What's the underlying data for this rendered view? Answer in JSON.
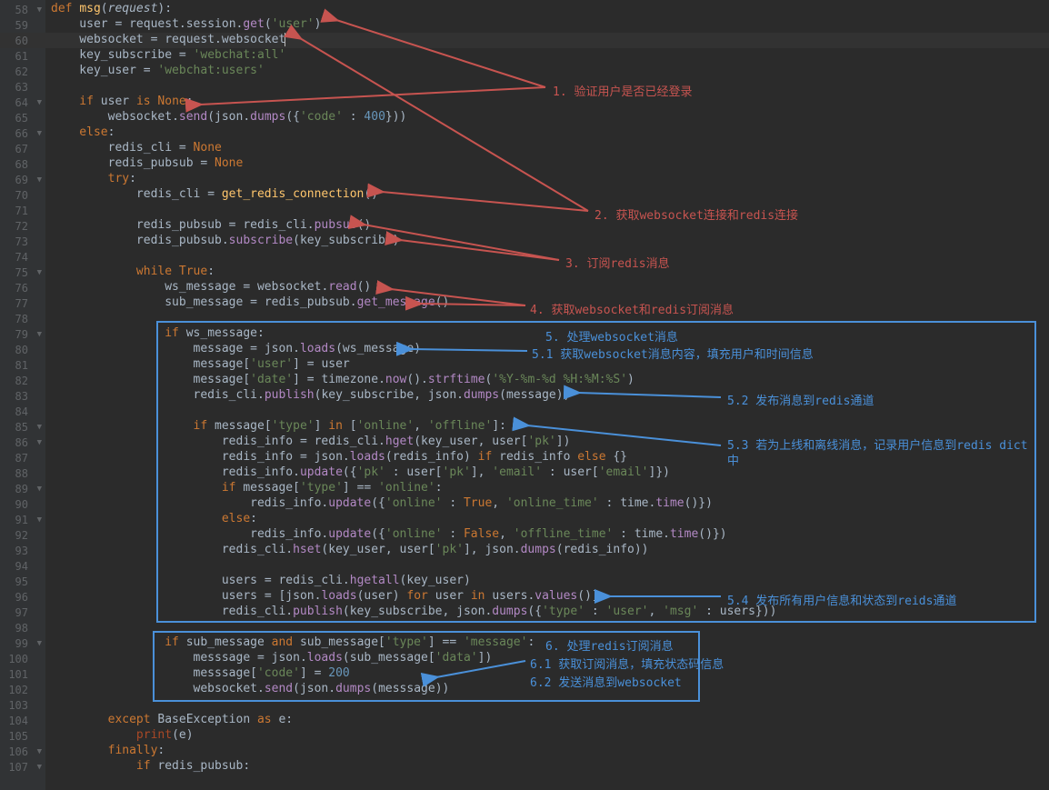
{
  "gutter": {
    "start": 58,
    "end": 107,
    "fold_lines": [
      58,
      64,
      66,
      69,
      75,
      79,
      85,
      86,
      89,
      91,
      99,
      106,
      107
    ],
    "highlight": 60
  },
  "code": [
    [
      [
        "kw",
        "def "
      ],
      [
        "fn",
        "msg"
      ],
      [
        "op",
        "("
      ],
      [
        "par",
        "request"
      ],
      [
        "op",
        "):"
      ]
    ],
    [
      [
        "id",
        "    user "
      ],
      [
        "op",
        "= "
      ],
      [
        "id",
        "request"
      ],
      [
        "op",
        "."
      ],
      [
        "id",
        "session"
      ],
      [
        "op",
        "."
      ],
      [
        "me",
        "get"
      ],
      [
        "op",
        "("
      ],
      [
        "str",
        "'user'"
      ],
      [
        "op",
        ")"
      ]
    ],
    [
      [
        "id",
        "    websocket "
      ],
      [
        "op",
        "= "
      ],
      [
        "id",
        "request"
      ],
      [
        "op",
        "."
      ],
      [
        "id",
        "websocket"
      ]
    ],
    [
      [
        "id",
        "    key_subscribe "
      ],
      [
        "op",
        "= "
      ],
      [
        "str",
        "'webchat:all'"
      ]
    ],
    [
      [
        "id",
        "    key_user "
      ],
      [
        "op",
        "= "
      ],
      [
        "str",
        "'webchat:users'"
      ]
    ],
    [
      [
        "id",
        ""
      ]
    ],
    [
      [
        "kw",
        "    if "
      ],
      [
        "id",
        "user "
      ],
      [
        "kw",
        "is "
      ],
      [
        "bl",
        "None"
      ],
      [
        "op",
        ":"
      ]
    ],
    [
      [
        "id",
        "        websocket"
      ],
      [
        "op",
        "."
      ],
      [
        "me",
        "send"
      ],
      [
        "op",
        "("
      ],
      [
        "id",
        "json"
      ],
      [
        "op",
        "."
      ],
      [
        "me",
        "dumps"
      ],
      [
        "op",
        "({"
      ],
      [
        "str",
        "'code'"
      ],
      [
        "op",
        " : "
      ],
      [
        "num",
        "400"
      ],
      [
        "op",
        "}))"
      ]
    ],
    [
      [
        "kw",
        "    else"
      ],
      [
        "op",
        ":"
      ]
    ],
    [
      [
        "id",
        "        redis_cli "
      ],
      [
        "op",
        "= "
      ],
      [
        "bl",
        "None"
      ]
    ],
    [
      [
        "id",
        "        redis_pubsub "
      ],
      [
        "op",
        "= "
      ],
      [
        "bl",
        "None"
      ]
    ],
    [
      [
        "kw",
        "        try"
      ],
      [
        "op",
        ":"
      ]
    ],
    [
      [
        "id",
        "            redis_cli "
      ],
      [
        "op",
        "= "
      ],
      [
        "fn",
        "get_redis_connection"
      ],
      [
        "op",
        "()"
      ]
    ],
    [
      [
        "id",
        ""
      ]
    ],
    [
      [
        "id",
        "            redis_pubsub "
      ],
      [
        "op",
        "= "
      ],
      [
        "id",
        "redis_cli"
      ],
      [
        "op",
        "."
      ],
      [
        "me",
        "pubsub"
      ],
      [
        "op",
        "()"
      ]
    ],
    [
      [
        "id",
        "            redis_pubsub"
      ],
      [
        "op",
        "."
      ],
      [
        "me",
        "subscribe"
      ],
      [
        "op",
        "("
      ],
      [
        "id",
        "key_subscribe"
      ],
      [
        "op",
        ")"
      ]
    ],
    [
      [
        "id",
        ""
      ]
    ],
    [
      [
        "kw",
        "            while "
      ],
      [
        "bl",
        "True"
      ],
      [
        "op",
        ":"
      ]
    ],
    [
      [
        "id",
        "                ws_message "
      ],
      [
        "op",
        "= "
      ],
      [
        "id",
        "websocket"
      ],
      [
        "op",
        "."
      ],
      [
        "me",
        "read"
      ],
      [
        "op",
        "()"
      ]
    ],
    [
      [
        "id",
        "                sub_message "
      ],
      [
        "op",
        "= "
      ],
      [
        "id",
        "redis_pubsub"
      ],
      [
        "op",
        "."
      ],
      [
        "me",
        "get_message"
      ],
      [
        "op",
        "()"
      ]
    ],
    [
      [
        "id",
        ""
      ]
    ],
    [
      [
        "kw",
        "                if "
      ],
      [
        "id",
        "ws_message"
      ],
      [
        "op",
        ":"
      ]
    ],
    [
      [
        "id",
        "                    message "
      ],
      [
        "op",
        "= "
      ],
      [
        "id",
        "json"
      ],
      [
        "op",
        "."
      ],
      [
        "me",
        "loads"
      ],
      [
        "op",
        "("
      ],
      [
        "id",
        "ws_message"
      ],
      [
        "op",
        ")"
      ]
    ],
    [
      [
        "id",
        "                    message"
      ],
      [
        "op",
        "["
      ],
      [
        "str",
        "'user'"
      ],
      [
        "op",
        "] = "
      ],
      [
        "id",
        "user"
      ]
    ],
    [
      [
        "id",
        "                    message"
      ],
      [
        "op",
        "["
      ],
      [
        "str",
        "'date'"
      ],
      [
        "op",
        "] = "
      ],
      [
        "id",
        "timezone"
      ],
      [
        "op",
        "."
      ],
      [
        "me",
        "now"
      ],
      [
        "op",
        "()."
      ],
      [
        "me",
        "strftime"
      ],
      [
        "op",
        "("
      ],
      [
        "str",
        "'%Y-%m-%d %H:%M:%S'"
      ],
      [
        "op",
        ")"
      ]
    ],
    [
      [
        "id",
        "                    redis_cli"
      ],
      [
        "op",
        "."
      ],
      [
        "me",
        "publish"
      ],
      [
        "op",
        "("
      ],
      [
        "id",
        "key_subscribe"
      ],
      [
        "op",
        ", "
      ],
      [
        "id",
        "json"
      ],
      [
        "op",
        "."
      ],
      [
        "me",
        "dumps"
      ],
      [
        "op",
        "("
      ],
      [
        "id",
        "message"
      ],
      [
        "op",
        "))"
      ]
    ],
    [
      [
        "id",
        ""
      ]
    ],
    [
      [
        "kw",
        "                    if "
      ],
      [
        "id",
        "message"
      ],
      [
        "op",
        "["
      ],
      [
        "str",
        "'type'"
      ],
      [
        "op",
        "] "
      ],
      [
        "kw",
        "in "
      ],
      [
        "op",
        "["
      ],
      [
        "str",
        "'online'"
      ],
      [
        "op",
        ", "
      ],
      [
        "str",
        "'offline'"
      ],
      [
        "op",
        "]:"
      ]
    ],
    [
      [
        "id",
        "                        redis_info "
      ],
      [
        "op",
        "= "
      ],
      [
        "id",
        "redis_cli"
      ],
      [
        "op",
        "."
      ],
      [
        "me",
        "hget"
      ],
      [
        "op",
        "("
      ],
      [
        "id",
        "key_user"
      ],
      [
        "op",
        ", "
      ],
      [
        "id",
        "user"
      ],
      [
        "op",
        "["
      ],
      [
        "str",
        "'pk'"
      ],
      [
        "op",
        "])"
      ]
    ],
    [
      [
        "id",
        "                        redis_info "
      ],
      [
        "op",
        "= "
      ],
      [
        "id",
        "json"
      ],
      [
        "op",
        "."
      ],
      [
        "me",
        "loads"
      ],
      [
        "op",
        "("
      ],
      [
        "id",
        "redis_info"
      ],
      [
        "op",
        ") "
      ],
      [
        "kw",
        "if "
      ],
      [
        "id",
        "redis_info "
      ],
      [
        "kw",
        "else "
      ],
      [
        "op",
        "{}"
      ]
    ],
    [
      [
        "id",
        "                        redis_info"
      ],
      [
        "op",
        "."
      ],
      [
        "me",
        "update"
      ],
      [
        "op",
        "({"
      ],
      [
        "str",
        "'pk'"
      ],
      [
        "op",
        " : "
      ],
      [
        "id",
        "user"
      ],
      [
        "op",
        "["
      ],
      [
        "str",
        "'pk'"
      ],
      [
        "op",
        "], "
      ],
      [
        "str",
        "'email'"
      ],
      [
        "op",
        " : "
      ],
      [
        "id",
        "user"
      ],
      [
        "op",
        "["
      ],
      [
        "str",
        "'email'"
      ],
      [
        "op",
        "]})"
      ]
    ],
    [
      [
        "kw",
        "                        if "
      ],
      [
        "id",
        "message"
      ],
      [
        "op",
        "["
      ],
      [
        "str",
        "'type'"
      ],
      [
        "op",
        "] == "
      ],
      [
        "str",
        "'online'"
      ],
      [
        "op",
        ":"
      ]
    ],
    [
      [
        "id",
        "                            redis_info"
      ],
      [
        "op",
        "."
      ],
      [
        "me",
        "update"
      ],
      [
        "op",
        "({"
      ],
      [
        "str",
        "'online'"
      ],
      [
        "op",
        " : "
      ],
      [
        "bl",
        "True"
      ],
      [
        "op",
        ", "
      ],
      [
        "str",
        "'online_time'"
      ],
      [
        "op",
        " : "
      ],
      [
        "id",
        "time"
      ],
      [
        "op",
        "."
      ],
      [
        "me",
        "time"
      ],
      [
        "op",
        "()})"
      ]
    ],
    [
      [
        "kw",
        "                        else"
      ],
      [
        "op",
        ":"
      ]
    ],
    [
      [
        "id",
        "                            redis_info"
      ],
      [
        "op",
        "."
      ],
      [
        "me",
        "update"
      ],
      [
        "op",
        "({"
      ],
      [
        "str",
        "'online'"
      ],
      [
        "op",
        " : "
      ],
      [
        "bl",
        "False"
      ],
      [
        "op",
        ", "
      ],
      [
        "str",
        "'offline_time'"
      ],
      [
        "op",
        " : "
      ],
      [
        "id",
        "time"
      ],
      [
        "op",
        "."
      ],
      [
        "me",
        "time"
      ],
      [
        "op",
        "()})"
      ]
    ],
    [
      [
        "id",
        "                        redis_cli"
      ],
      [
        "op",
        "."
      ],
      [
        "me",
        "hset"
      ],
      [
        "op",
        "("
      ],
      [
        "id",
        "key_user"
      ],
      [
        "op",
        ", "
      ],
      [
        "id",
        "user"
      ],
      [
        "op",
        "["
      ],
      [
        "str",
        "'pk'"
      ],
      [
        "op",
        "], "
      ],
      [
        "id",
        "json"
      ],
      [
        "op",
        "."
      ],
      [
        "me",
        "dumps"
      ],
      [
        "op",
        "("
      ],
      [
        "id",
        "redis_info"
      ],
      [
        "op",
        "))"
      ]
    ],
    [
      [
        "id",
        ""
      ]
    ],
    [
      [
        "id",
        "                        users "
      ],
      [
        "op",
        "= "
      ],
      [
        "id",
        "redis_cli"
      ],
      [
        "op",
        "."
      ],
      [
        "me",
        "hgetall"
      ],
      [
        "op",
        "("
      ],
      [
        "id",
        "key_user"
      ],
      [
        "op",
        ")"
      ]
    ],
    [
      [
        "id",
        "                        users "
      ],
      [
        "op",
        "= ["
      ],
      [
        "id",
        "json"
      ],
      [
        "op",
        "."
      ],
      [
        "me",
        "loads"
      ],
      [
        "op",
        "("
      ],
      [
        "id",
        "user"
      ],
      [
        "op",
        ") "
      ],
      [
        "kw",
        "for "
      ],
      [
        "id",
        "user "
      ],
      [
        "kw",
        "in "
      ],
      [
        "id",
        "users"
      ],
      [
        "op",
        "."
      ],
      [
        "me",
        "values"
      ],
      [
        "op",
        "()]"
      ]
    ],
    [
      [
        "id",
        "                        redis_cli"
      ],
      [
        "op",
        "."
      ],
      [
        "me",
        "publish"
      ],
      [
        "op",
        "("
      ],
      [
        "id",
        "key_subscribe"
      ],
      [
        "op",
        ", "
      ],
      [
        "id",
        "json"
      ],
      [
        "op",
        "."
      ],
      [
        "me",
        "dumps"
      ],
      [
        "op",
        "({"
      ],
      [
        "str",
        "'type'"
      ],
      [
        "op",
        " : "
      ],
      [
        "str",
        "'user'"
      ],
      [
        "op",
        ", "
      ],
      [
        "str",
        "'msg'"
      ],
      [
        "op",
        " : "
      ],
      [
        "id",
        "users"
      ],
      [
        "op",
        "}))"
      ]
    ],
    [
      [
        "id",
        ""
      ]
    ],
    [
      [
        "kw",
        "                if "
      ],
      [
        "id",
        "sub_message "
      ],
      [
        "kw",
        "and "
      ],
      [
        "id",
        "sub_message"
      ],
      [
        "op",
        "["
      ],
      [
        "str",
        "'type'"
      ],
      [
        "op",
        "] == "
      ],
      [
        "str",
        "'message'"
      ],
      [
        "op",
        ":"
      ]
    ],
    [
      [
        "id",
        "                    messsage "
      ],
      [
        "op",
        "= "
      ],
      [
        "id",
        "json"
      ],
      [
        "op",
        "."
      ],
      [
        "me",
        "loads"
      ],
      [
        "op",
        "("
      ],
      [
        "id",
        "sub_message"
      ],
      [
        "op",
        "["
      ],
      [
        "str",
        "'data'"
      ],
      [
        "op",
        "])"
      ]
    ],
    [
      [
        "id",
        "                    messsage"
      ],
      [
        "op",
        "["
      ],
      [
        "str",
        "'code'"
      ],
      [
        "op",
        "] = "
      ],
      [
        "num",
        "200"
      ]
    ],
    [
      [
        "id",
        "                    websocket"
      ],
      [
        "op",
        "."
      ],
      [
        "me",
        "send"
      ],
      [
        "op",
        "("
      ],
      [
        "id",
        "json"
      ],
      [
        "op",
        "."
      ],
      [
        "me",
        "dumps"
      ],
      [
        "op",
        "("
      ],
      [
        "id",
        "messsage"
      ],
      [
        "op",
        "))"
      ]
    ],
    [
      [
        "id",
        ""
      ]
    ],
    [
      [
        "kw",
        "        except "
      ],
      [
        "id",
        "BaseException "
      ],
      [
        "kw",
        "as "
      ],
      [
        "id",
        "e"
      ],
      [
        "op",
        ":"
      ]
    ],
    [
      [
        "id",
        "            "
      ],
      [
        "sf",
        "print"
      ],
      [
        "op",
        "("
      ],
      [
        "id",
        "e"
      ],
      [
        "op",
        ")"
      ]
    ],
    [
      [
        "kw",
        "        finally"
      ],
      [
        "op",
        ":"
      ]
    ],
    [
      [
        "kw",
        "            if "
      ],
      [
        "id",
        "redis_pubsub"
      ],
      [
        "op",
        ":"
      ]
    ]
  ],
  "annotations_red": {
    "a1": "1. 验证用户是否已经登录",
    "a2": "2. 获取websocket连接和redis连接",
    "a3": "3. 订阅redis消息",
    "a4": "4. 获取websocket和redis订阅消息"
  },
  "annotations_blue": {
    "b5": "5. 处理websocket消息",
    "b51": "5.1 获取websocket消息内容，填充用户和时间信息",
    "b52": "5.2 发布消息到redis通道",
    "b53": "5.3 若为上线和离线消息，记录用户信息到redis dict中",
    "b54": "5.4 发布所有用户信息和状态到reids通道",
    "b6": "6. 处理redis订阅消息",
    "b61": "6.1 获取订阅消息，填充状态码信息",
    "b62": "6.2 发送消息到websocket"
  }
}
